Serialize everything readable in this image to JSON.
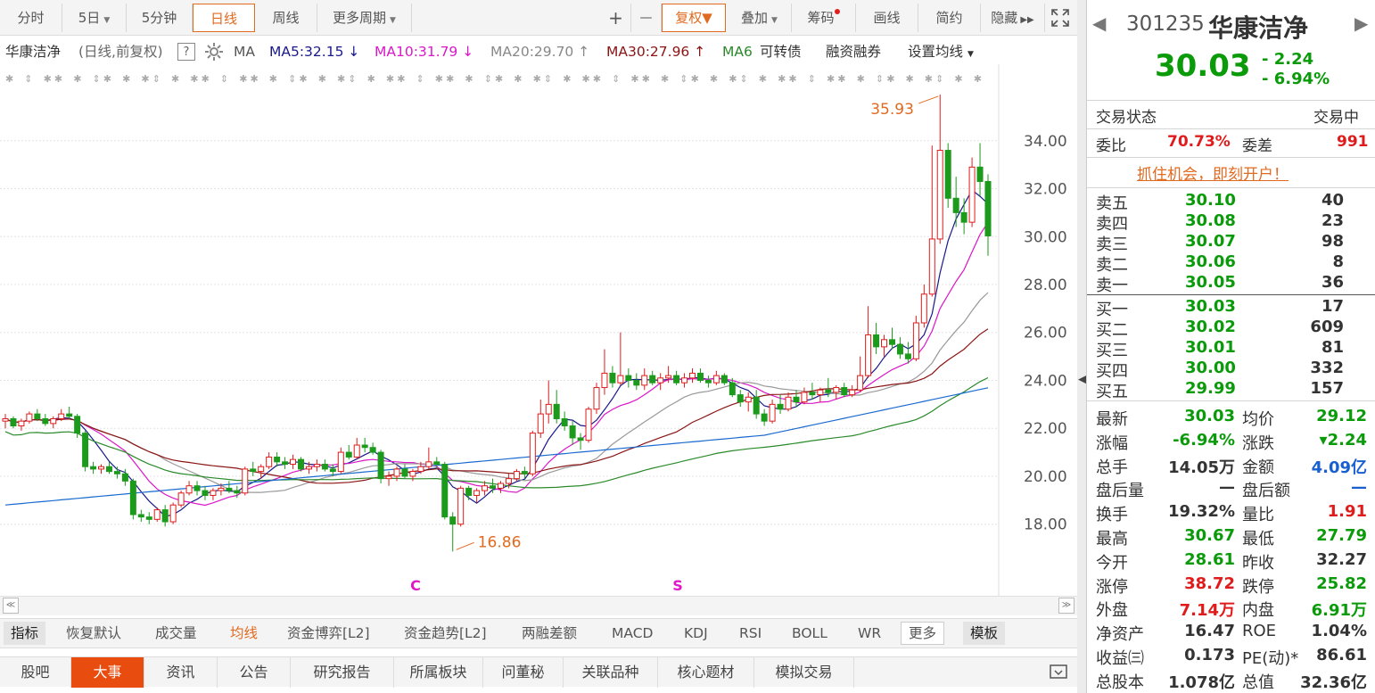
{
  "toolbar": {
    "periods": [
      "分时",
      "5日",
      "5分钟",
      "日线",
      "周线",
      "更多周期"
    ],
    "active_period": "日线",
    "right_buttons": [
      "+",
      "—",
      "复权",
      "叠加",
      "筹码",
      "画线",
      "简约",
      "隐藏"
    ]
  },
  "ma_line": {
    "stock_label": "华康洁净",
    "mode": "(日线,前复权)",
    "help": "?",
    "ma_label": "MA",
    "ma5": "MA5:32.15",
    "ma10": "MA10:31.79",
    "ma20": "MA20:29.70",
    "ma30": "MA30:27.96",
    "ma60": "MA6",
    "extra1": "可转债",
    "extra2": "融资融券",
    "extra3": "设置均线"
  },
  "chart_data": {
    "type": "candlestick",
    "y_ticks": [
      "34.00",
      "32.00",
      "30.00",
      "28.00",
      "26.00",
      "24.00",
      "22.00",
      "20.00",
      "18.00"
    ],
    "ylim": [
      16.5,
      36.3
    ],
    "high_label": "35.93",
    "low_label": "16.86",
    "markers": [
      "C",
      "S"
    ],
    "candles": [
      [
        22.3,
        22.6,
        22.0,
        22.4
      ],
      [
        22.4,
        22.5,
        22.0,
        22.1
      ],
      [
        22.1,
        22.4,
        21.9,
        22.3
      ],
      [
        22.3,
        22.7,
        22.2,
        22.6
      ],
      [
        22.6,
        22.8,
        22.3,
        22.4
      ],
      [
        22.4,
        22.6,
        22.1,
        22.2
      ],
      [
        22.2,
        22.5,
        22.0,
        22.4
      ],
      [
        22.4,
        22.8,
        22.3,
        22.6
      ],
      [
        22.6,
        22.9,
        22.4,
        22.5
      ],
      [
        22.5,
        22.6,
        21.6,
        21.8
      ],
      [
        21.8,
        21.9,
        20.2,
        20.4
      ],
      [
        20.4,
        20.6,
        20.1,
        20.3
      ],
      [
        20.3,
        20.5,
        20.1,
        20.4
      ],
      [
        20.4,
        20.6,
        20.1,
        20.2
      ],
      [
        20.2,
        20.4,
        19.9,
        20.1
      ],
      [
        20.1,
        20.3,
        19.6,
        19.8
      ],
      [
        19.8,
        19.9,
        18.2,
        18.4
      ],
      [
        18.4,
        18.6,
        18.1,
        18.3
      ],
      [
        18.3,
        18.5,
        18.0,
        18.2
      ],
      [
        18.2,
        18.7,
        18.1,
        18.6
      ],
      [
        18.6,
        18.8,
        17.9,
        18.1
      ],
      [
        18.1,
        18.9,
        18.0,
        18.8
      ],
      [
        18.8,
        19.4,
        18.7,
        19.3
      ],
      [
        19.3,
        19.8,
        19.2,
        19.6
      ],
      [
        19.6,
        19.8,
        19.2,
        19.4
      ],
      [
        19.4,
        19.6,
        19.0,
        19.2
      ],
      [
        19.2,
        19.5,
        19.0,
        19.4
      ],
      [
        19.4,
        19.7,
        19.2,
        19.5
      ],
      [
        19.5,
        19.8,
        19.3,
        19.4
      ],
      [
        19.4,
        19.6,
        19.1,
        19.3
      ],
      [
        19.3,
        20.4,
        19.2,
        20.3
      ],
      [
        20.3,
        20.6,
        20.0,
        20.2
      ],
      [
        20.2,
        20.5,
        19.9,
        20.4
      ],
      [
        20.4,
        21.0,
        20.3,
        20.8
      ],
      [
        20.8,
        21.0,
        20.4,
        20.6
      ],
      [
        20.6,
        20.8,
        20.3,
        20.5
      ],
      [
        20.5,
        20.9,
        20.3,
        20.7
      ],
      [
        20.7,
        20.8,
        20.2,
        20.3
      ],
      [
        20.3,
        20.6,
        20.1,
        20.4
      ],
      [
        20.4,
        20.7,
        20.2,
        20.5
      ],
      [
        20.5,
        20.7,
        20.2,
        20.3
      ],
      [
        20.3,
        20.5,
        20.0,
        20.2
      ],
      [
        20.2,
        21.2,
        20.1,
        21.0
      ],
      [
        21.0,
        21.3,
        20.7,
        20.8
      ],
      [
        20.8,
        21.6,
        20.7,
        21.3
      ],
      [
        21.3,
        21.6,
        21.0,
        21.2
      ],
      [
        21.2,
        21.4,
        20.9,
        21.0
      ],
      [
        21.0,
        21.1,
        19.7,
        19.9
      ],
      [
        19.9,
        20.2,
        19.6,
        20.0
      ],
      [
        20.0,
        20.4,
        19.8,
        20.3
      ],
      [
        20.3,
        20.5,
        19.9,
        20.0
      ],
      [
        20.0,
        20.3,
        19.8,
        20.2
      ],
      [
        20.2,
        20.6,
        20.1,
        20.4
      ],
      [
        20.4,
        21.2,
        20.3,
        20.6
      ],
      [
        20.6,
        20.8,
        20.3,
        20.5
      ],
      [
        20.5,
        20.6,
        18.2,
        18.3
      ],
      [
        18.3,
        18.5,
        16.86,
        18.0
      ],
      [
        18.0,
        19.6,
        17.9,
        19.5
      ],
      [
        19.5,
        19.6,
        19.0,
        19.2
      ],
      [
        19.2,
        19.5,
        18.9,
        19.4
      ],
      [
        19.4,
        19.8,
        19.2,
        19.6
      ],
      [
        19.6,
        19.9,
        19.3,
        19.5
      ],
      [
        19.5,
        19.8,
        19.3,
        19.7
      ],
      [
        19.7,
        20.1,
        19.5,
        19.9
      ],
      [
        19.9,
        20.3,
        19.8,
        20.2
      ],
      [
        20.2,
        20.4,
        19.9,
        20.1
      ],
      [
        20.1,
        21.9,
        20.0,
        21.8
      ],
      [
        21.8,
        23.2,
        21.6,
        22.6
      ],
      [
        22.6,
        24.0,
        22.2,
        23.0
      ],
      [
        23.0,
        23.6,
        22.2,
        22.4
      ],
      [
        22.4,
        22.7,
        21.9,
        22.1
      ],
      [
        22.1,
        22.3,
        21.3,
        21.6
      ],
      [
        21.6,
        21.8,
        21.1,
        21.5
      ],
      [
        21.5,
        22.9,
        21.4,
        22.8
      ],
      [
        22.8,
        23.9,
        22.6,
        23.7
      ],
      [
        23.7,
        25.3,
        23.4,
        24.3
      ],
      [
        24.3,
        24.6,
        23.7,
        23.9
      ],
      [
        23.9,
        26.0,
        23.8,
        24.2
      ],
      [
        24.2,
        24.5,
        23.7,
        24.0
      ],
      [
        24.0,
        24.3,
        23.6,
        23.8
      ],
      [
        23.8,
        24.5,
        23.6,
        24.2
      ],
      [
        24.2,
        24.4,
        23.8,
        23.9
      ],
      [
        23.9,
        24.3,
        23.6,
        24.1
      ],
      [
        24.1,
        24.6,
        23.9,
        24.2
      ],
      [
        24.2,
        24.4,
        23.8,
        23.9
      ],
      [
        23.9,
        24.3,
        23.7,
        24.1
      ],
      [
        24.1,
        24.5,
        23.9,
        24.3
      ],
      [
        24.3,
        24.5,
        23.9,
        24.0
      ],
      [
        24.0,
        24.2,
        23.7,
        23.9
      ],
      [
        23.9,
        24.4,
        23.8,
        24.2
      ],
      [
        24.2,
        24.3,
        23.8,
        23.9
      ],
      [
        23.9,
        24.1,
        23.3,
        23.4
      ],
      [
        23.4,
        23.6,
        22.9,
        23.1
      ],
      [
        23.1,
        23.5,
        22.7,
        23.3
      ],
      [
        23.3,
        23.6,
        22.4,
        22.6
      ],
      [
        22.6,
        22.8,
        22.1,
        22.3
      ],
      [
        22.3,
        23.2,
        22.2,
        23.0
      ],
      [
        23.0,
        23.4,
        22.6,
        22.8
      ],
      [
        22.8,
        23.5,
        22.7,
        23.3
      ],
      [
        23.3,
        23.6,
        22.9,
        23.1
      ],
      [
        23.1,
        23.7,
        23.0,
        23.5
      ],
      [
        23.5,
        23.9,
        23.2,
        23.4
      ],
      [
        23.4,
        23.7,
        23.1,
        23.6
      ],
      [
        23.6,
        24.1,
        23.3,
        23.5
      ],
      [
        23.5,
        23.8,
        23.2,
        23.7
      ],
      [
        23.7,
        23.9,
        23.3,
        23.4
      ],
      [
        23.4,
        23.8,
        23.3,
        23.6
      ],
      [
        23.6,
        25.0,
        23.5,
        24.2
      ],
      [
        24.2,
        27.1,
        24.1,
        25.9
      ],
      [
        25.9,
        26.4,
        25.1,
        25.4
      ],
      [
        25.4,
        25.9,
        25.0,
        25.7
      ],
      [
        25.7,
        26.2,
        25.3,
        25.5
      ],
      [
        25.5,
        25.8,
        24.9,
        25.1
      ],
      [
        25.1,
        25.6,
        24.7,
        24.9
      ],
      [
        24.9,
        26.7,
        24.8,
        26.4
      ],
      [
        26.4,
        28.0,
        26.2,
        27.6
      ],
      [
        27.6,
        33.8,
        27.5,
        29.9
      ],
      [
        29.9,
        35.93,
        29.7,
        33.6
      ],
      [
        33.6,
        33.9,
        31.2,
        31.6
      ],
      [
        31.6,
        32.5,
        30.4,
        31.0
      ],
      [
        31.0,
        31.6,
        30.1,
        30.6
      ],
      [
        30.6,
        33.3,
        30.4,
        32.9
      ],
      [
        32.9,
        33.9,
        31.7,
        32.3
      ],
      [
        32.3,
        32.6,
        29.2,
        30.03
      ]
    ],
    "ma_series": {
      "ma5": "32.15",
      "ma10": "31.79",
      "ma20": "29.70",
      "ma30": "27.96"
    }
  },
  "indicator_tabs": [
    "指标",
    "恢复默认",
    "成交量",
    "均线",
    "资金博弈[L2]",
    "资金趋势[L2]",
    "两融差额",
    "MACD",
    "KDJ",
    "RSI",
    "BOLL",
    "WR",
    "更多",
    "模板"
  ],
  "indicator_active": "均线",
  "news_tabs": [
    "股吧",
    "大事",
    "资讯",
    "公告",
    "研究报告",
    "所属板块",
    "问董秘",
    "关联品种",
    "核心题材",
    "模拟交易"
  ],
  "news_active": "大事",
  "quote": {
    "code": "301235",
    "name": "华康洁净",
    "price": "30.03",
    "change": "- 2.24",
    "change_pct": "- 6.94%",
    "status_label": "交易状态",
    "status_value": "交易中",
    "webi_label": "委比",
    "webi_value": "70.73%",
    "weicha_label": "委差",
    "weicha_value": "991",
    "promo": "抓住机会，即刻开户！",
    "asks": [
      {
        "label": "卖五",
        "price": "30.10",
        "vol": "40"
      },
      {
        "label": "卖四",
        "price": "30.08",
        "vol": "23"
      },
      {
        "label": "卖三",
        "price": "30.07",
        "vol": "98"
      },
      {
        "label": "卖二",
        "price": "30.06",
        "vol": "8"
      },
      {
        "label": "卖一",
        "price": "30.05",
        "vol": "36"
      }
    ],
    "bids": [
      {
        "label": "买一",
        "price": "30.03",
        "vol": "17"
      },
      {
        "label": "买二",
        "price": "30.02",
        "vol": "609"
      },
      {
        "label": "买三",
        "price": "30.01",
        "vol": "81"
      },
      {
        "label": "买四",
        "price": "30.00",
        "vol": "332"
      },
      {
        "label": "买五",
        "price": "29.99",
        "vol": "157"
      }
    ],
    "stats": [
      [
        "最新",
        "30.03",
        "green",
        "均价",
        "29.12",
        "green"
      ],
      [
        "涨幅",
        "-6.94%",
        "green",
        "涨跌",
        "▾2.24",
        "green"
      ],
      [
        "总手",
        "14.05万",
        "dark",
        "金额",
        "4.09亿",
        "blue"
      ],
      [
        "盘后量",
        "—",
        "dark",
        "盘后额",
        "—",
        "blue"
      ],
      [
        "换手",
        "19.32%",
        "dark",
        "量比",
        "1.91",
        "red"
      ],
      [
        "最高",
        "30.67",
        "green",
        "最低",
        "27.79",
        "green"
      ],
      [
        "今开",
        "28.61",
        "green",
        "昨收",
        "32.27",
        "dark"
      ],
      [
        "涨停",
        "38.72",
        "red",
        "跌停",
        "25.82",
        "green"
      ],
      [
        "外盘",
        "7.14万",
        "red",
        "内盘",
        "6.91万",
        "green"
      ],
      [
        "净资产",
        "16.47",
        "dark",
        "ROE",
        "1.04%",
        "dark"
      ],
      [
        "收益㈢",
        "0.173",
        "dark",
        "PE(动)*",
        "86.61",
        "dark"
      ],
      [
        "总股本",
        "1.078亿",
        "dark",
        "总值",
        "32.36亿",
        "dark"
      ]
    ]
  }
}
